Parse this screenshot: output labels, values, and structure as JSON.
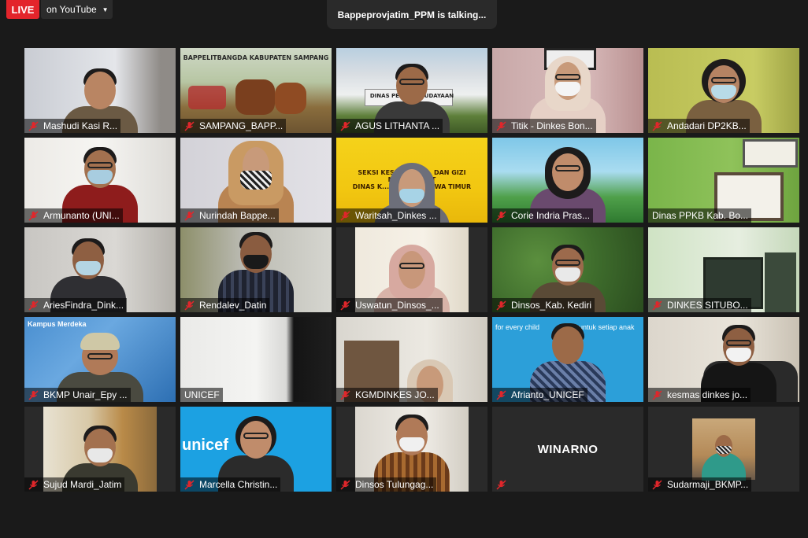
{
  "header": {
    "live_label": "LIVE",
    "stream_target": "on YouTube",
    "talking_indicator": "Bappeprovjatim_PPM is talking..."
  },
  "colors": {
    "live_red": "#e3242b",
    "mute_red": "#e0262b",
    "background": "#1a1a1a"
  },
  "participants": [
    {
      "name": "Mashudi  Kasi  R...",
      "muted": true
    },
    {
      "name": "SAMPANG_BAPP...",
      "muted": true
    },
    {
      "name": "AGUS LITHANTA ...",
      "muted": true
    },
    {
      "name": "Titik - Dinkes Bon...",
      "muted": true
    },
    {
      "name": "Andadari DP2KB...",
      "muted": true
    },
    {
      "name": "Armunanto (UNI...",
      "muted": true
    },
    {
      "name": "Nurindah Bappe...",
      "muted": true
    },
    {
      "name": "Waritsah_Dinkes ...",
      "muted": true
    },
    {
      "name": "Corie Indria Pras...",
      "muted": true
    },
    {
      "name": "Dinas PPKB Kab. Bo...",
      "muted": false
    },
    {
      "name": "AriesFindra_Dink...",
      "muted": true
    },
    {
      "name": "Rendalev_Datin",
      "muted": true
    },
    {
      "name": "Uswatun_Dinsos_...",
      "muted": true
    },
    {
      "name": "Dinsos_Kab. Kediri",
      "muted": true
    },
    {
      "name": "DINKES SITUBO...",
      "muted": true
    },
    {
      "name": "BKMP Unair_Epy ...",
      "muted": true
    },
    {
      "name": "UNICEF",
      "muted": false
    },
    {
      "name": "KGMDINKES JO...",
      "muted": true
    },
    {
      "name": "Afrianto_UNICEF",
      "muted": true
    },
    {
      "name": "kesmas dinkes jo...",
      "muted": true
    },
    {
      "name": "Sujud Mardi_Jatim",
      "muted": true
    },
    {
      "name": "Marcella Christin...",
      "muted": true
    },
    {
      "name": "Dinsos Tulungag...",
      "muted": true
    },
    {
      "name": "",
      "muted": true,
      "display_name": "WINARNO"
    },
    {
      "name": "Sudarmaji_BKMP...",
      "muted": true
    }
  ],
  "tile_text": {
    "sampang_banner": "BAPPELITBANGDA KABUPATEN SAMPANG",
    "agus_sign": "DINAS PEN... KEBUDAYAAN",
    "waritsah_banner_1": "SEKSI KESEHATAN ... DAN GIZI MASYARAKAT",
    "waritsah_banner_2": "DINAS K... PROVINSI JAWA TIMUR",
    "bkmp_logo": "Kampus Merdeka",
    "unicef_logo": "unicef",
    "unicef_tagline": "for every child",
    "afrianto_tagline": "untuk setiap anak"
  }
}
